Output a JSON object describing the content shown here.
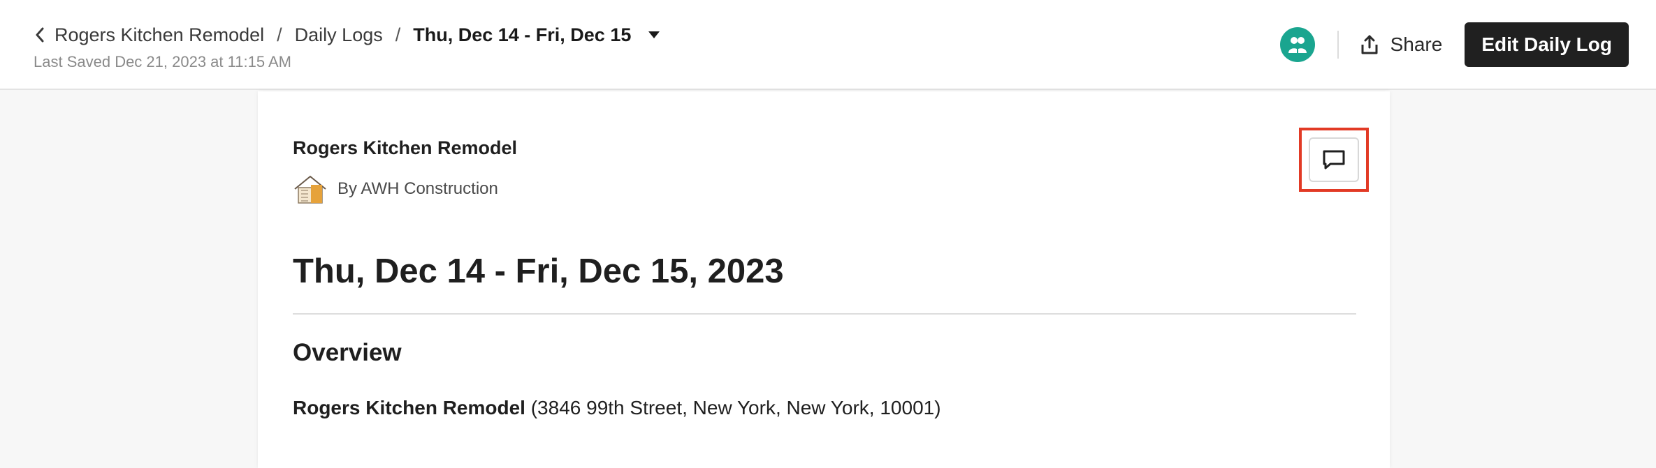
{
  "header": {
    "breadcrumb": {
      "project": "Rogers Kitchen Remodel",
      "section": "Daily Logs",
      "current": "Thu, Dec 14 - Fri, Dec 15",
      "separator": "/"
    },
    "last_saved": "Last Saved Dec 21, 2023 at 11:15 AM",
    "share_label": "Share",
    "edit_label": "Edit Daily Log"
  },
  "icons": {
    "back": "chevron-left-icon",
    "caret": "caret-down-icon",
    "avatar": "users-icon",
    "share": "share-upload-icon",
    "comment": "comment-icon",
    "logo": "house-logo-icon"
  },
  "colors": {
    "avatar_bg": "#1aa58f",
    "primary_button": "#202020",
    "highlight": "#e23a25"
  },
  "content": {
    "project_name": "Rogers Kitchen Remodel",
    "company": "By AWH Construction",
    "date_title": "Thu, Dec 14 - Fri, Dec 15, 2023",
    "overview_heading": "Overview",
    "overview_project": "Rogers Kitchen Remodel",
    "overview_address": "(3846 99th Street, New York, New York, 10001)"
  }
}
